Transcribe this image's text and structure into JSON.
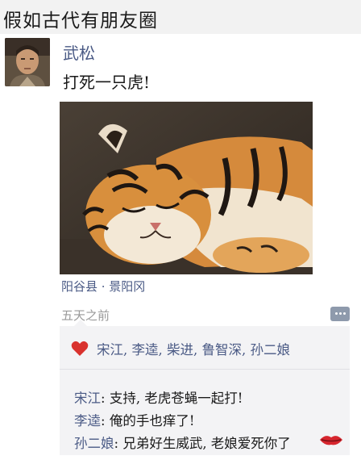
{
  "page": {
    "title": "假如古代有朋友圈"
  },
  "post": {
    "author": "武松",
    "text": "打死一只虎!",
    "location": "阳谷县 · 景阳冈",
    "time": "五天之前"
  },
  "icons": {
    "avatar": "avatar-portrait",
    "photo": "tiger-photo",
    "comment": "comment-bubble-icon",
    "like": "heart-icon",
    "kiss": "lips-icon"
  },
  "colors": {
    "name_blue": "#4a5a85",
    "heart_red": "#d9322e",
    "box_bg": "#f3f3f5"
  },
  "likes": {
    "names": "宋江, 李逵, 柴进, 鲁智深, 孙二娘"
  },
  "comments": [
    {
      "author": "宋江",
      "sep": ": ",
      "text": "支持, 老虎苍蝇一起打!"
    },
    {
      "author": "李逵",
      "sep": ": ",
      "text": "俺的手也痒了!"
    },
    {
      "author": "孙二娘",
      "sep": ": ",
      "text": "兄弟好生威武, 老娘爱死你了"
    }
  ]
}
